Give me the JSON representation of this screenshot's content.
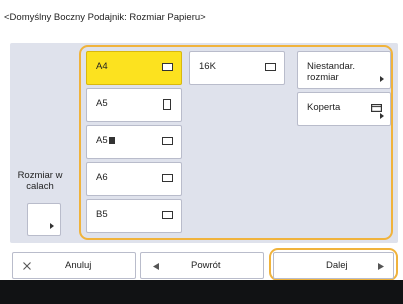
{
  "header": {
    "title": "<Domyślny Boczny Podajnik: Rozmiar Papieru>"
  },
  "sizes": {
    "a4": "A4",
    "a5": "A5",
    "a5r": "A5",
    "a6": "A6",
    "b5": "B5",
    "k16": "16K",
    "nonstandard_line1": "Niestandar.",
    "nonstandard_line2": "rozmiar",
    "envelope": "Koperta"
  },
  "inch": {
    "line1": "Rozmiar w",
    "line2": "calach"
  },
  "footer": {
    "cancel": "Anuluj",
    "back": "Powrót",
    "next": "Dalej"
  },
  "icons": {
    "cancel": "close-icon",
    "back": "arrow-left-icon",
    "next": "arrow-right-icon",
    "paper": "paper-orientation-icon",
    "envelope": "envelope-icon"
  },
  "colors": {
    "selected": "#fce21f",
    "focus_frame": "#f0b33c",
    "panel": "#dfe2ec"
  }
}
